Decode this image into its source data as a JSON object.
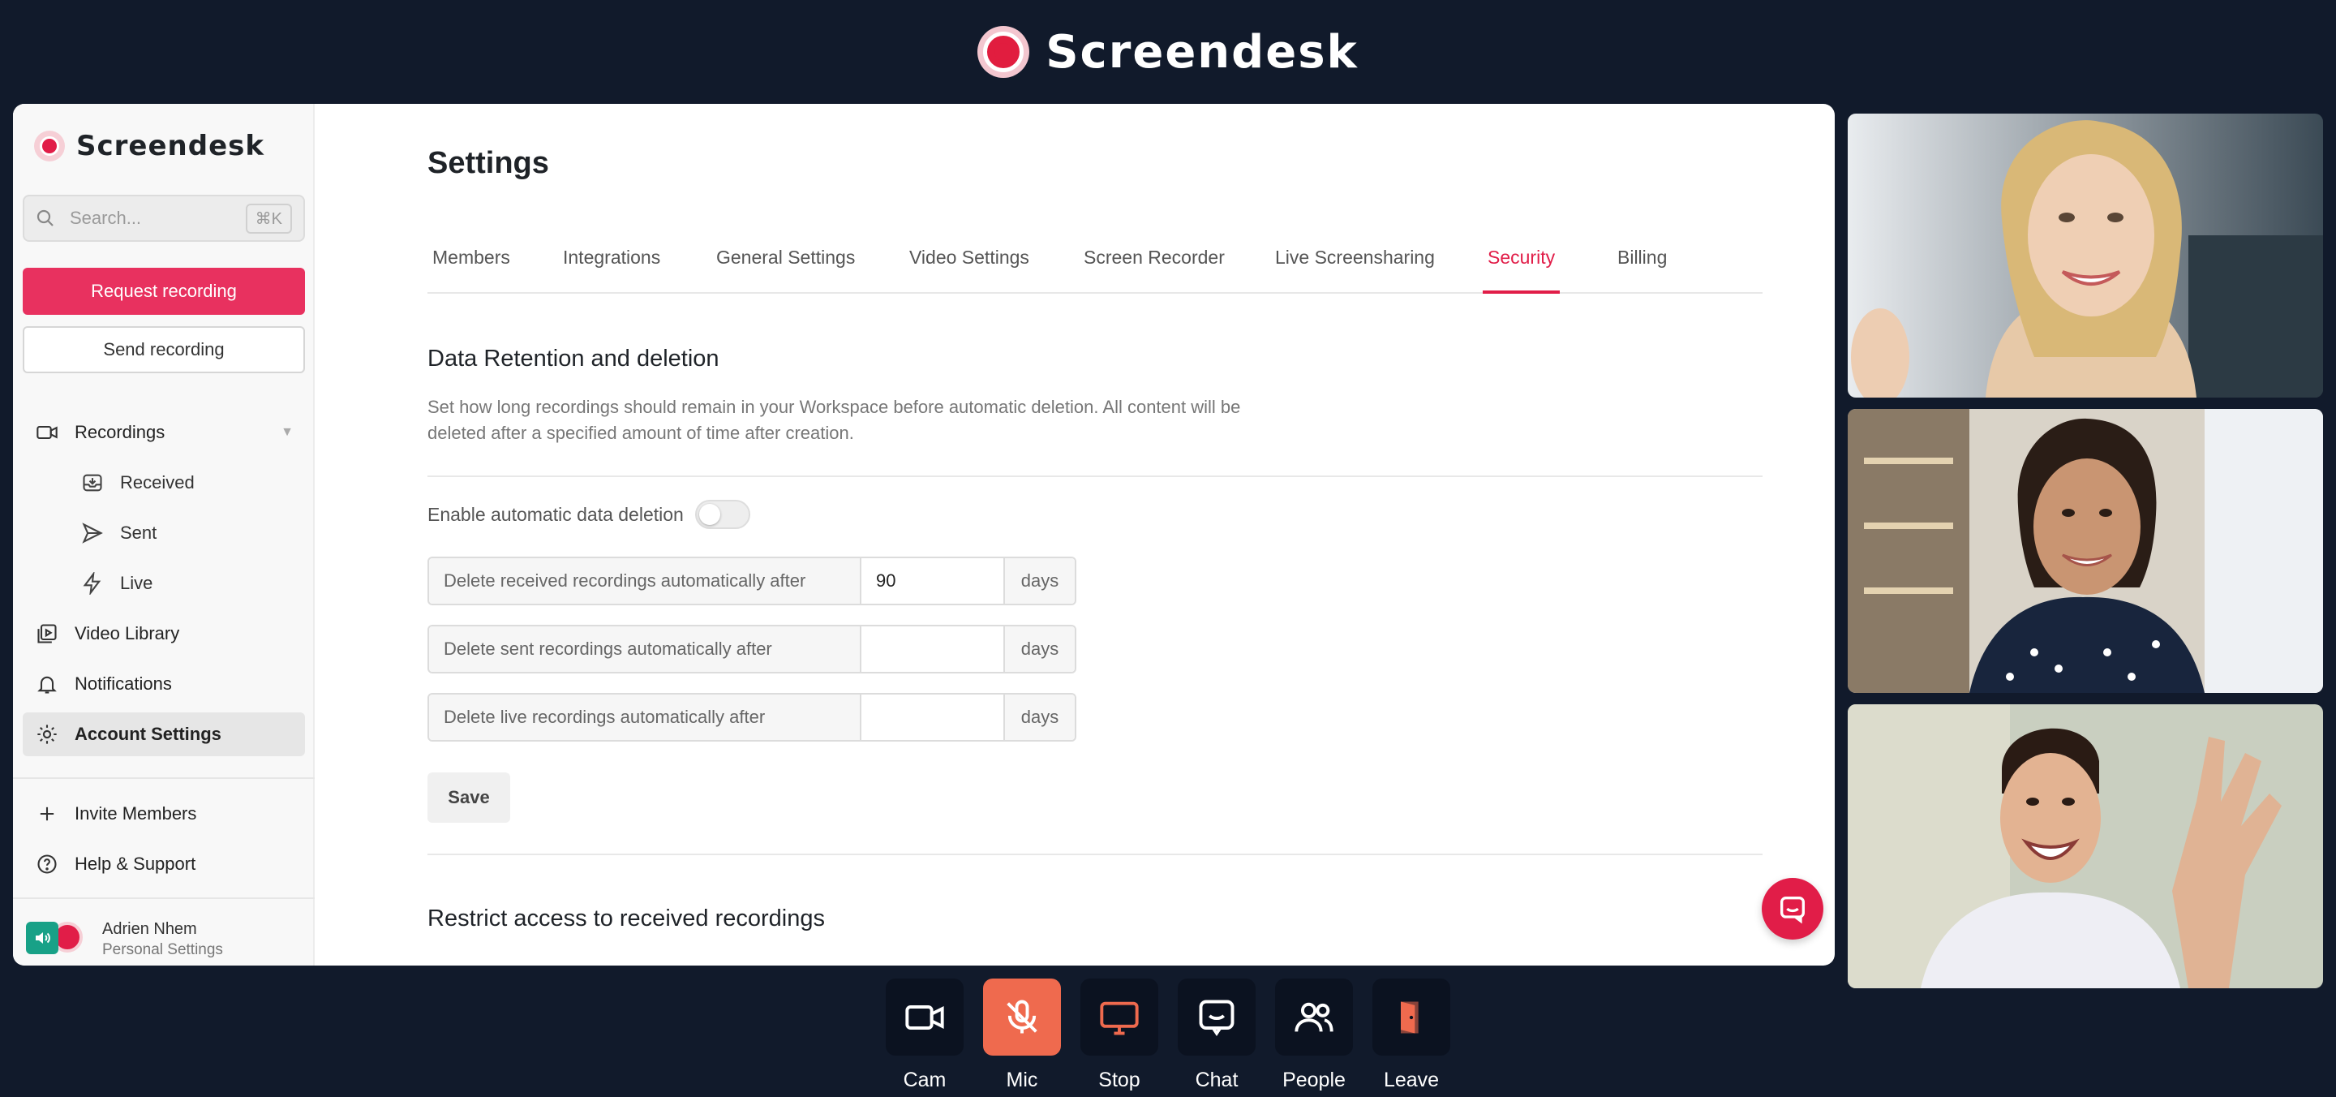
{
  "app": {
    "title": "Screendesk"
  },
  "sidebar": {
    "brand": "Screendesk",
    "search": {
      "placeholder": "Search...",
      "shortcut": "⌘K"
    },
    "request_button": "Request recording",
    "send_button": "Send recording",
    "items": [
      {
        "label": "Recordings",
        "icon": "video-camera-icon"
      },
      {
        "label": "Received",
        "icon": "inbox-icon"
      },
      {
        "label": "Sent",
        "icon": "send-icon"
      },
      {
        "label": "Live",
        "icon": "lightning-icon"
      },
      {
        "label": "Video Library",
        "icon": "library-icon"
      },
      {
        "label": "Notifications",
        "icon": "bell-icon"
      },
      {
        "label": "Account Settings",
        "icon": "gear-icon"
      },
      {
        "label": "Invite Members",
        "icon": "plus-icon"
      },
      {
        "label": "Help & Support",
        "icon": "help-icon"
      }
    ],
    "user": {
      "name": "Adrien Nhem",
      "subtitle": "Personal Settings"
    }
  },
  "main": {
    "title": "Settings",
    "tabs": [
      {
        "label": "Members"
      },
      {
        "label": "Integrations"
      },
      {
        "label": "General Settings"
      },
      {
        "label": "Video Settings"
      },
      {
        "label": "Screen Recorder"
      },
      {
        "label": "Live Screensharing"
      },
      {
        "label": "Security",
        "active": true
      },
      {
        "label": "Billing"
      }
    ],
    "retention": {
      "title": "Data Retention and deletion",
      "description": "Set how long recordings should remain in your Workspace before automatic deletion. All content will be deleted after a specified amount of time after creation.",
      "toggle_label": "Enable automatic data deletion",
      "toggle_on": false,
      "fields": [
        {
          "label": "Delete received recordings automatically after",
          "value": "90",
          "unit": "days"
        },
        {
          "label": "Delete sent recordings automatically after",
          "value": "",
          "unit": "days"
        },
        {
          "label": "Delete live recordings automatically after",
          "value": "",
          "unit": "days"
        }
      ],
      "save_label": "Save"
    },
    "restrict": {
      "title": "Restrict access to received recordings"
    }
  },
  "call_controls": [
    {
      "label": "Cam",
      "icon": "camera-icon"
    },
    {
      "label": "Mic",
      "icon": "mic-off-icon",
      "color": "#ef6a4e"
    },
    {
      "label": "Stop",
      "icon": "screen-share-icon"
    },
    {
      "label": "Chat",
      "icon": "chat-icon"
    },
    {
      "label": "People",
      "icon": "people-icon"
    },
    {
      "label": "Leave",
      "icon": "leave-door-icon"
    }
  ],
  "colors": {
    "accent": "#e11d48",
    "background": "#111a2b",
    "mic_active": "#ef6a4e"
  }
}
